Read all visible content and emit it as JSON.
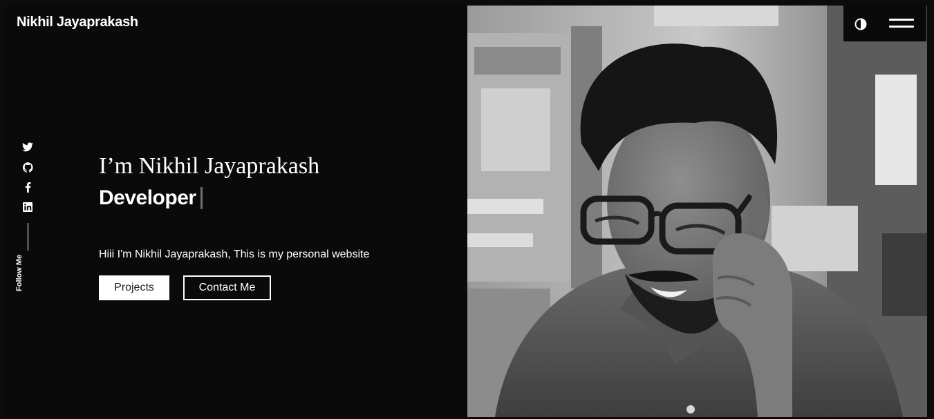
{
  "header": {
    "brand": "Nikhil Jayaprakash"
  },
  "social": {
    "icons": [
      "twitter-icon",
      "github-icon",
      "facebook-icon",
      "linkedin-icon"
    ],
    "follow_label": "Follow Me"
  },
  "hero": {
    "title": "I’m Nikhil Jayaprakash",
    "role": "Developer",
    "tagline": "Hiii I'm Nikhil Jayaprakash, This is my personal website",
    "buttons": {
      "projects": "Projects",
      "contact": "Contact Me"
    }
  },
  "colors": {
    "background": "#0b0a0b",
    "text": "#ffffff",
    "button_fill": "#ffffff"
  }
}
